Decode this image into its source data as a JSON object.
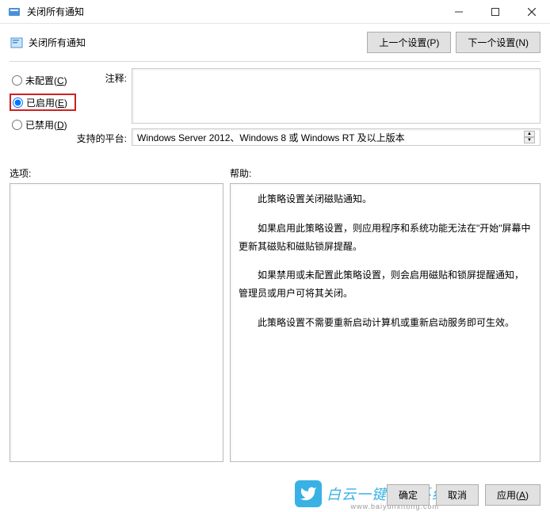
{
  "window": {
    "title": "关闭所有通知"
  },
  "toolbar": {
    "title": "关闭所有通知",
    "prev_button": "上一个设置(P)",
    "next_button": "下一个设置(N)"
  },
  "radios": {
    "not_configured": "未配置(C)",
    "enabled": "已启用(E)",
    "disabled": "已禁用(D)",
    "selected": "enabled"
  },
  "fields": {
    "comment_label": "注释:",
    "comment_value": "",
    "platform_label": "支持的平台:",
    "platform_value": "Windows Server 2012、Windows 8 或 Windows RT 及以上版本"
  },
  "labels": {
    "options": "选项:",
    "help": "帮助:"
  },
  "help_text": [
    "此策略设置关闭磁贴通知。",
    "如果启用此策略设置，则应用程序和系统功能无法在\"开始\"屏幕中更新其磁贴和磁贴锁屏提醒。",
    "如果禁用或未配置此策略设置，则会启用磁贴和锁屏提醒通知，管理员或用户可将其关闭。",
    "此策略设置不需要重新启动计算机或重新启动服务即可生效。"
  ],
  "footer": {
    "ok": "确定",
    "cancel": "取消",
    "apply": "应用(A)"
  },
  "watermark": {
    "brand": "白云一键重装系统",
    "url": "www.baiyunxitong.com"
  }
}
